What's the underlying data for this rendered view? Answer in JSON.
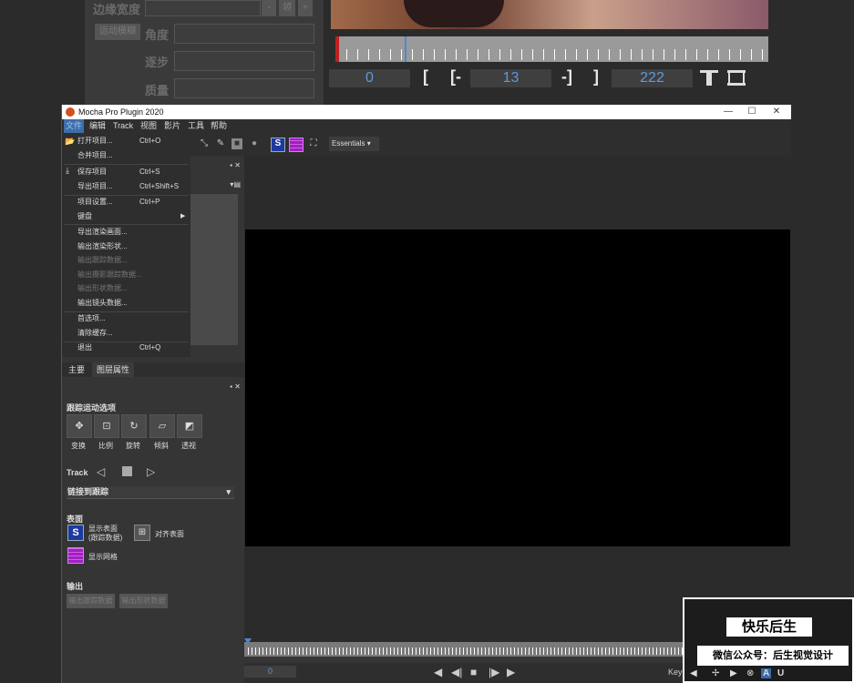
{
  "host": {
    "edge_width_label": "边缘宽度",
    "angle_label": "角度",
    "step_label": "逐步",
    "quality_label": "质量",
    "motion_blur_btn": "运动模糊",
    "minus_btn": "-",
    "mid_btn": "领",
    "plus_btn": "+",
    "frame_start": "0",
    "bracket_open": "[",
    "range_open": "[-",
    "frame_mid": "13",
    "range_close": "-]",
    "bracket_close": "]",
    "frame_end": "222"
  },
  "window": {
    "title": "Mocha Pro Plugin 2020",
    "minimize": "—",
    "maximize": "☐",
    "close": "✕"
  },
  "menubar": [
    "文件",
    "编辑",
    "Track",
    "视图",
    "影片",
    "工具",
    "帮助"
  ],
  "toolbar": {
    "workspace": "Essentials"
  },
  "file_menu": {
    "items": [
      {
        "label": "打开项目...",
        "shortcut": "Ctrl+O"
      },
      {
        "label": "合并项目...",
        "shortcut": ""
      },
      {
        "label": "保存项目",
        "shortcut": "Ctrl+S"
      },
      {
        "label": "导出项目...",
        "shortcut": "Ctrl+Shift+S"
      },
      {
        "label": "项目设置...",
        "shortcut": "Ctrl+P"
      },
      {
        "label": "键盘",
        "shortcut": ""
      },
      {
        "label": "导出渲染画面...",
        "shortcut": ""
      },
      {
        "label": "输出渲染形状...",
        "shortcut": ""
      },
      {
        "label": "输出跟踪数据...",
        "shortcut": ""
      },
      {
        "label": "输出摄影跟踪数据...",
        "shortcut": ""
      },
      {
        "label": "输出形状数据...",
        "shortcut": ""
      },
      {
        "label": "输出镜头数据...",
        "shortcut": ""
      },
      {
        "label": "首选项...",
        "shortcut": ""
      },
      {
        "label": "清除缓存...",
        "shortcut": ""
      },
      {
        "label": "退出",
        "shortcut": "Ctrl+Q"
      }
    ]
  },
  "panel": {
    "tabs": [
      "主要",
      "图层属性"
    ],
    "track_motion_header": "跟踪运动选项",
    "motion_buttons": [
      "变换",
      "比例",
      "旋转",
      "倾斜",
      "透视"
    ],
    "track_label": "Track",
    "link_to_track": "链接到跟踪",
    "surface_header": "表面",
    "show_surface": "显示表面",
    "show_surface_sub": "(跟踪数据)",
    "align_surface": "对齐表面",
    "show_grid": "显示网格",
    "output_header": "输出",
    "output_btn1": "输出跟踪数据",
    "output_btn2": "输出形状数据"
  },
  "viewer": {
    "frame": "0",
    "key_label": "Key"
  },
  "watermark": {
    "title": "快乐后生",
    "subtitle": "微信公众号：后生视觉设计"
  }
}
